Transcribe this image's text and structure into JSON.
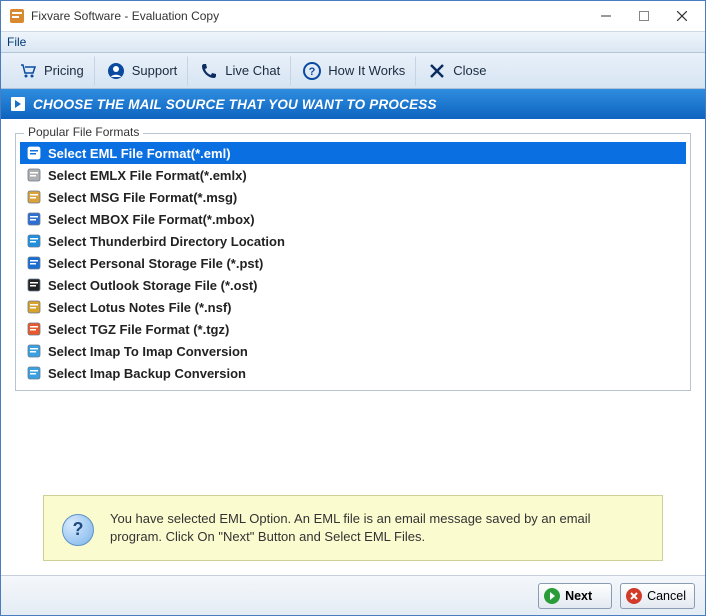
{
  "window": {
    "title": "Fixvare Software - Evaluation Copy"
  },
  "menubar": {
    "file": "File"
  },
  "toolbar": {
    "pricing": "Pricing",
    "support": "Support",
    "livechat": "Live Chat",
    "howitworks": "How It Works",
    "close": "Close"
  },
  "section": {
    "heading": "CHOOSE THE MAIL SOURCE THAT YOU WANT TO PROCESS"
  },
  "groupbox": {
    "legend": "Popular File Formats"
  },
  "formats": [
    {
      "label": "Select EML File Format(*.eml)",
      "icon": "file-eml",
      "selected": true
    },
    {
      "label": "Select EMLX File Format(*.emlx)",
      "icon": "file-emlx",
      "selected": false
    },
    {
      "label": "Select MSG File Format(*.msg)",
      "icon": "file-msg",
      "selected": false
    },
    {
      "label": "Select MBOX File Format(*.mbox)",
      "icon": "file-mbox",
      "selected": false
    },
    {
      "label": "Select Thunderbird Directory Location",
      "icon": "thunderbird",
      "selected": false
    },
    {
      "label": "Select Personal Storage File (*.pst)",
      "icon": "outlook-pst",
      "selected": false
    },
    {
      "label": "Select Outlook Storage File (*.ost)",
      "icon": "outlook-ost",
      "selected": false
    },
    {
      "label": "Select Lotus Notes File (*.nsf)",
      "icon": "lotus-nsf",
      "selected": false
    },
    {
      "label": "Select TGZ File Format (*.tgz)",
      "icon": "file-tgz",
      "selected": false
    },
    {
      "label": "Select Imap To Imap Conversion",
      "icon": "imap-sync",
      "selected": false
    },
    {
      "label": "Select Imap Backup Conversion",
      "icon": "imap-backup",
      "selected": false
    }
  ],
  "info": {
    "text": "You have selected EML Option. An EML file is an email message saved by an email program. Click On \"Next\" Button and Select EML Files."
  },
  "footer": {
    "next": "Next",
    "cancel": "Cancel"
  },
  "iconColors": {
    "file-eml": "#ffffff",
    "file-emlx": "#b0b0b0",
    "file-msg": "#d9a33a",
    "file-mbox": "#2d6fd0",
    "thunderbird": "#1f8fe0",
    "outlook-pst": "#1b6ed1",
    "outlook-ost": "#222",
    "lotus-nsf": "#d7a32a",
    "file-tgz": "#e85a2c",
    "imap-sync": "#3aa0e0",
    "imap-backup": "#3aa0e0"
  }
}
